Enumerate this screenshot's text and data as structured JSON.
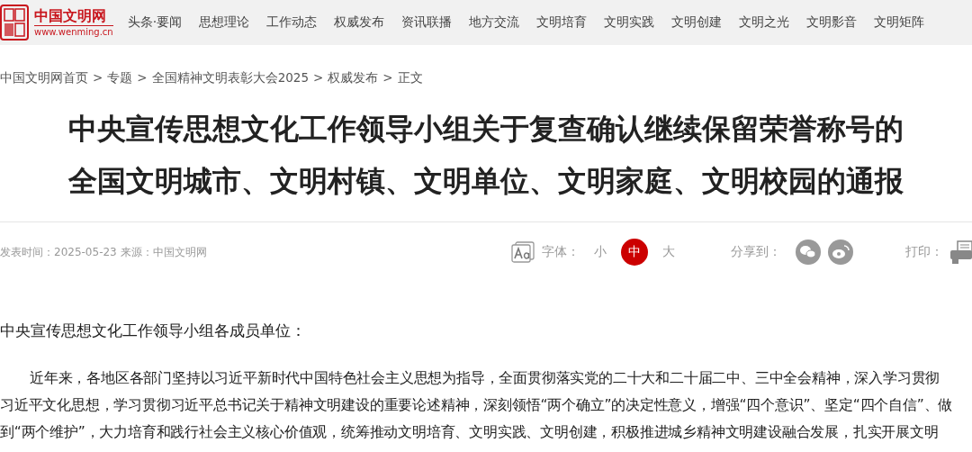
{
  "header": {
    "logo_title": "中国文明网",
    "logo_url": "www.wenming.cn",
    "nav": [
      "头条·要闻",
      "思想理论",
      "工作动态",
      "权威发布",
      "资讯联播",
      "地方交流",
      "文明培育",
      "文明实践",
      "文明创建",
      "文明之光",
      "文明影音",
      "文明矩阵"
    ]
  },
  "breadcrumb": [
    "中国文明网首页",
    "专题",
    "全国精神文明表彰大会2025",
    "权威发布",
    "正文"
  ],
  "breadcrumb_separator": ">",
  "title_lines": [
    "中央宣传思想文化工作领导小组关于复查确认继续保留荣誉称号的",
    "全国文明城市、文明村镇、文明单位、文明家庭、文明校园的通报"
  ],
  "meta": {
    "info": "发表时间：2025-05-23 来源：中国文明网",
    "font_label": "字体：",
    "font_sizes": [
      {
        "label": "小",
        "selected": false
      },
      {
        "label": "中",
        "selected": true
      },
      {
        "label": "大",
        "selected": false
      }
    ],
    "share_label": "分享到：",
    "print_label": "打印："
  },
  "body": {
    "salutation": "中央宣传思想文化工作领导小组各成员单位：",
    "lines": [
      "近年来，各地区各部门坚持以习近平新时代中国特色社会主义思想为指导，全面贯彻落实党的二十大和二十届二中、三中全会精神，深入学习贯彻",
      "习近平文化思想，学习贯彻习近平总书记关于精神文明建设的重要论述精神，深刻领悟“两个确立”的决定性意义，增强“四个意识”、坚定“四个自信”、做",
      "到“两个维护”，大力培育和践行社会主义核心价值观，统筹推动文明培育、文明实践、文明创建，积极推进城乡精神文明建设融合发展，扎实开展文明"
    ]
  }
}
